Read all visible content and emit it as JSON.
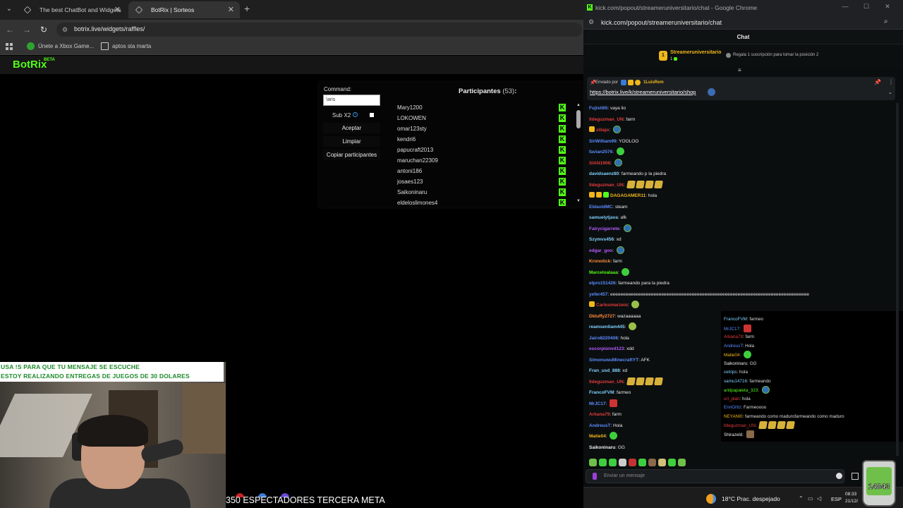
{
  "left_browser": {
    "tabs": [
      {
        "title": "The best ChatBot and Widgets"
      },
      {
        "title": "BotRix | Sorteos"
      }
    ],
    "url": "botrix.live/widgets/raffles/",
    "bookmarks": [
      {
        "label": "Únete a Xbox Game..."
      },
      {
        "label": "aptos sta marta"
      }
    ]
  },
  "botrix": {
    "logo": "BotRix",
    "beta": "BETA",
    "command_label": "Command:",
    "command_value": "!aris",
    "sub_label": "Sub X2",
    "buttons": {
      "accept": "Aceptar",
      "clear": "Limpiar",
      "copy": "Copiar participantes"
    },
    "participants_title": "Participantes",
    "participants_count": "(53)",
    "participants_suffix": ":",
    "participants": [
      "Mary1200",
      "LOKOWEN",
      "omar123sty",
      "kendri6",
      "papucraft2013",
      "maruchan22309",
      "antoni186",
      "josaes123",
      "Saikoninaru",
      "eldeloslimones4"
    ]
  },
  "webcam": {
    "caption_line1": "USA !S PARA QUE TU MENSAJE SE ESCUCHE",
    "caption_line2": "ESTOY REALIZANDO ENTREGAS DE JUEGOS DE 30 DOLARES"
  },
  "ticker": "350 ESPECTADORES TERCERA META",
  "chat_window": {
    "title": "kick.com/popout/streameruniversitario/chat - Google Chrome",
    "url": "kick.com/popout/streameruniversitario/chat",
    "header": "Chat",
    "top_gifter": {
      "rank": "1",
      "user": "Streameruniversitario",
      "subs": "1",
      "gift_text": "Regala 1 suscripción para tomar la posición 2"
    },
    "pinned": {
      "by_label": "Enviado por",
      "user": "1LuisRem",
      "link": "https://botrix.live/k/streameruniversitario/shop"
    },
    "messages": [
      {
        "user": "Fujisti65",
        "color": "#5a8cff",
        "text": "vaya lio",
        "emotes": []
      },
      {
        "user": "lldeguzman_UN",
        "color": "#e23b3b",
        "text": "farm",
        "emotes": []
      },
      {
        "user": "zillajo",
        "color": "#e23b3b",
        "text": "",
        "emotes": [
          "pepe"
        ],
        "badges": [
          "#f0b71b"
        ]
      },
      {
        "user": "SirWilliam99",
        "color": "#5a8cff",
        "text": "YOOLOO",
        "emotes": []
      },
      {
        "user": "favian2576",
        "color": "#5a8cff",
        "text": "",
        "emotes": [
          "green"
        ]
      },
      {
        "user": "SIAN1908",
        "color": "#e23b3b",
        "text": "",
        "emotes": [
          "pepe"
        ]
      },
      {
        "user": "davidsaenz80",
        "color": "#7fd1ff",
        "text": "farmeando p la piedra",
        "emotes": []
      },
      {
        "user": "lldeguzman_UN",
        "color": "#e23b3b",
        "text": "",
        "emotes": [
          "gold",
          "gold",
          "gold",
          "gold"
        ]
      },
      {
        "user": "DAGAGAMER11",
        "color": "#f0b71b",
        "text": "hola",
        "emotes": [],
        "badges": [
          "#f0b71b",
          "#f0b71b",
          "#53fc18"
        ]
      },
      {
        "user": "EldavidMC",
        "color": "#5a8cff",
        "text": "steam",
        "emotes": []
      },
      {
        "user": "samuelytjava",
        "color": "#7fd1ff",
        "text": "afk",
        "emotes": []
      },
      {
        "user": "Fairycigarrete",
        "color": "#b45cff",
        "text": "",
        "emotes": [
          "pepe"
        ]
      },
      {
        "user": "Szymvs456",
        "color": "#7fd1ff",
        "text": "xd",
        "emotes": []
      },
      {
        "user": "edgar_goo",
        "color": "#b45cff",
        "text": "",
        "emotes": [
          "pepe"
        ]
      },
      {
        "user": "Kronotick",
        "color": "#ff8c3a",
        "text": "farm",
        "emotes": []
      },
      {
        "user": "Marceloalaaa",
        "color": "#53fc18",
        "text": "",
        "emotes": [
          "green"
        ]
      },
      {
        "user": "elpro151426",
        "color": "#5a8cff",
        "text": "farmeando para la piedra",
        "emotes": []
      },
      {
        "user": "yefer457",
        "color": "#5a8cff",
        "text": "eeeeeeeeeeeeeeeeeeeeeeeeeeeeeeeeeeeeeeeeeeeeeeeeeeeeeeeeeeeeeeeeeeeeeeeeeeeeee",
        "emotes": []
      },
      {
        "user": "Carlosmarzeio",
        "color": "#e23b3b",
        "text": "",
        "emotes": [
          "pepeg"
        ],
        "badges": [
          "#f0b71b"
        ]
      },
      {
        "user": "Dkluffy2727",
        "color": "#ff8c3a",
        "text": "wazaaaaaa",
        "emotes": []
      },
      {
        "user": "reamsenliam445",
        "color": "#7fd1ff",
        "text": "",
        "emotes": [
          "pepeg"
        ]
      },
      {
        "user": "Jairo8220408",
        "color": "#5a8cff",
        "text": "hola",
        "emotes": []
      },
      {
        "user": "escorpionvd123",
        "color": "#b45cff",
        "text": "xdd",
        "emotes": []
      },
      {
        "user": "SimonuwuMinecraftYT",
        "color": "#5a8cff",
        "text": "AFK",
        "emotes": []
      },
      {
        "user": "Fran_usd_888",
        "color": "#7fd1ff",
        "text": "xd",
        "emotes": []
      },
      {
        "user": "lldeguzman_UN",
        "color": "#e23b3b",
        "text": "",
        "emotes": [
          "gold",
          "gold",
          "gold",
          "gold"
        ]
      },
      {
        "user": "FrancoFVM",
        "color": "#7fd1ff",
        "text": "farmeo",
        "emotes": []
      },
      {
        "user": "MrJC17",
        "color": "#5a8cff",
        "text": "",
        "emotes": [
          "red"
        ]
      },
      {
        "user": "Arkana79",
        "color": "#e23b3b",
        "text": "farm",
        "emotes": []
      },
      {
        "user": "AndreusT",
        "color": "#5a8cff",
        "text": "Hola",
        "emotes": []
      },
      {
        "user": "Matie04",
        "color": "#f0b71b",
        "text": "",
        "emotes": [
          "green"
        ]
      },
      {
        "user": "Saikoninaru",
        "color": "#eeeeee",
        "text": "GG",
        "emotes": []
      }
    ],
    "overlay_messages": [
      {
        "user": "FrancoFVM",
        "color": "#7fd1ff",
        "text": "farmeo",
        "emotes": []
      },
      {
        "user": "MrJC17",
        "color": "#5a8cff",
        "text": "",
        "emotes": [
          "red"
        ]
      },
      {
        "user": "Arkana79",
        "color": "#e23b3b",
        "text": "farm",
        "emotes": []
      },
      {
        "user": "AndreusT",
        "color": "#5a8cff",
        "text": "Hola",
        "emotes": []
      },
      {
        "user": "Matie04",
        "color": "#f0b71b",
        "text": "",
        "emotes": [
          "green"
        ]
      },
      {
        "user": "Saikoninaru",
        "color": "#eeeeee",
        "text": "GG",
        "emotes": []
      },
      {
        "user": "cetrips",
        "color": "#7fd1ff",
        "text": "hola",
        "emotes": []
      },
      {
        "user": "samu14716",
        "color": "#7fd1ff",
        "text": "farmeando",
        "emotes": []
      },
      {
        "user": "antipapaleta_323",
        "color": "#53fc18",
        "text": "",
        "emotes": [
          "pepe"
        ]
      },
      {
        "user": "uri_plan",
        "color": "#e23b3b",
        "text": "hola",
        "emotes": []
      },
      {
        "user": "EnriOrtiz",
        "color": "#5a8cff",
        "text": "Farmeoooo",
        "emotes": []
      },
      {
        "user": "NEYANI0",
        "color": "#f0b71b",
        "text": "farmeando como madurofarmeando como maduro",
        "emotes": []
      },
      {
        "user": "lldeguzman_UN",
        "color": "#e23b3b",
        "text": "",
        "emotes": [
          "gold",
          "gold",
          "gold",
          "gold"
        ]
      },
      {
        "user": "Shirazeld",
        "color": "#eeeeee",
        "text": "",
        "emotes": [
          "brown"
        ]
      }
    ],
    "input_placeholder": "Enviar un mensaje",
    "emote_bar": [
      "#6fbf4a",
      "#3ecf3e",
      "#3ecf3e",
      "#cccccc",
      "#c33333",
      "#3ecf3e",
      "#8a6a4a",
      "#cfc07a",
      "#3ecf3e",
      "#6fbf4a"
    ]
  },
  "taskbar": {
    "weather": "18°C  Prac. despejado",
    "lang": "ESP",
    "time": "08:33",
    "date": "21/12/",
    "cup_count": "14843"
  },
  "colors": {
    "kick_green": "#53fc18",
    "gold": "#f0b71b",
    "caption_green": "#1d8a2a"
  }
}
